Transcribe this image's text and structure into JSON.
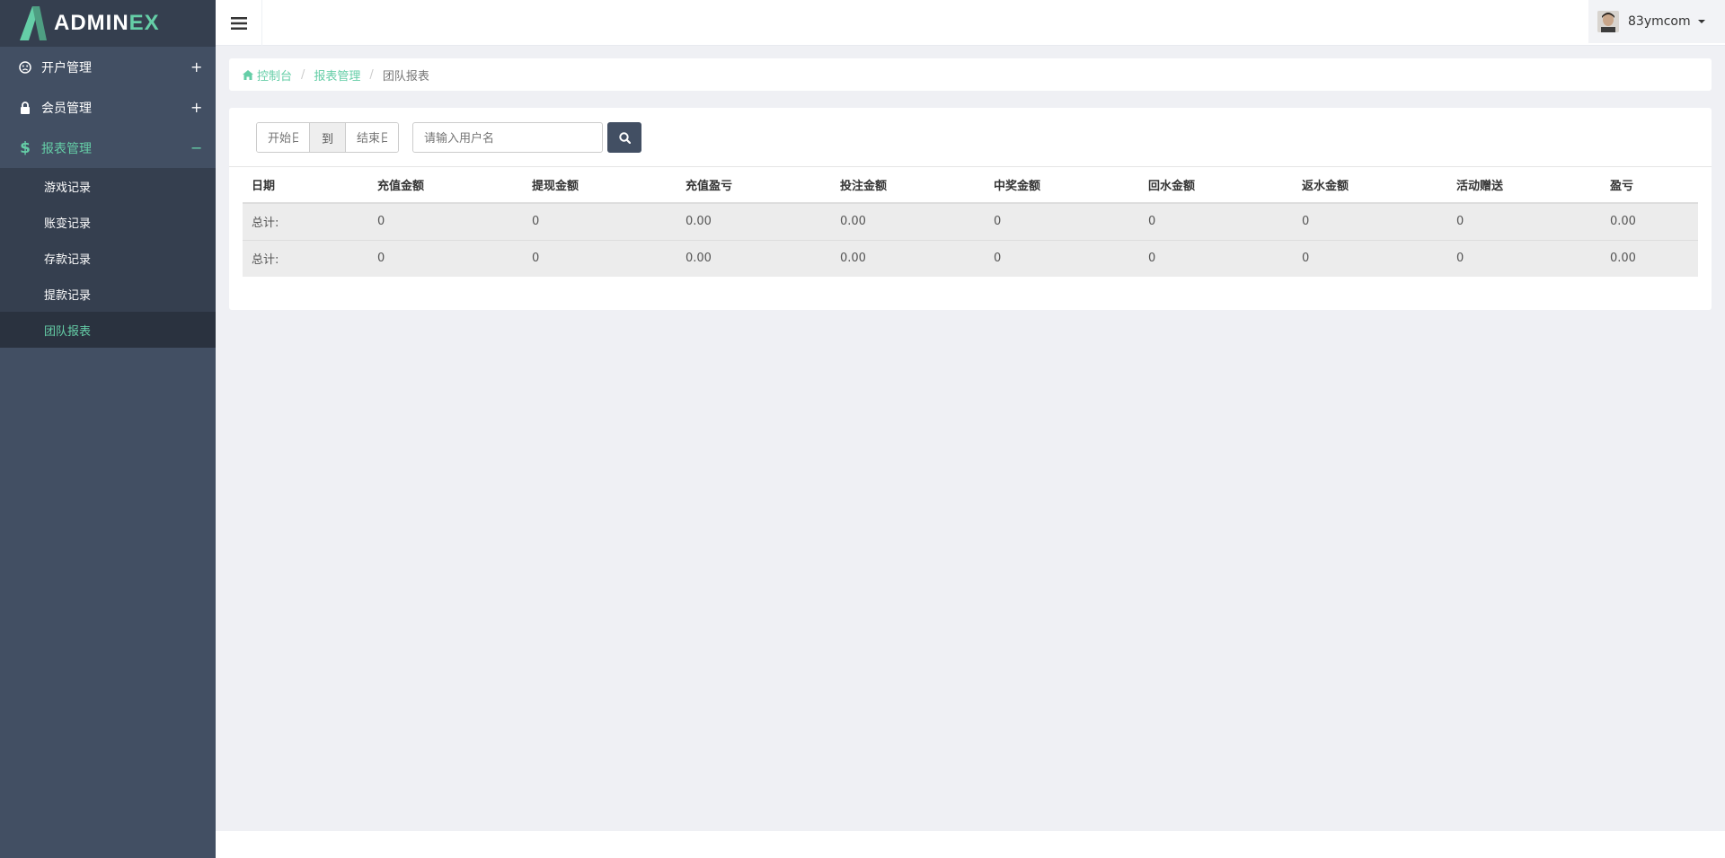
{
  "brand": {
    "name_main": "ADMIN",
    "name_accent": "EX"
  },
  "sidebar": {
    "menu": [
      {
        "label": "开户管理",
        "icon": "frown-icon",
        "toggle": "+"
      },
      {
        "label": "会员管理",
        "icon": "lock-icon",
        "toggle": "+"
      },
      {
        "label": "报表管理",
        "icon": "dollar-icon",
        "toggle": "−"
      }
    ],
    "submenu": [
      {
        "label": "游戏记录"
      },
      {
        "label": "账变记录"
      },
      {
        "label": "存款记录"
      },
      {
        "label": "提款记录"
      },
      {
        "label": "团队报表"
      }
    ]
  },
  "header": {
    "username": "83ymcom"
  },
  "breadcrumb": {
    "home": "控制台",
    "section": "报表管理",
    "current": "团队报表"
  },
  "filter": {
    "start_placeholder": "开始日期",
    "separator": "到",
    "end_placeholder": "结束日期",
    "user_placeholder": "请输入用户名"
  },
  "table": {
    "headers": [
      "日期",
      "充值金额",
      "提现金额",
      "充值盈亏",
      "投注金额",
      "中奖金额",
      "回水金额",
      "返水金额",
      "活动赠送",
      "盈亏"
    ],
    "rows": [
      [
        "总计:",
        "0",
        "0",
        "0.00",
        "0.00",
        "0",
        "0",
        "0",
        "0",
        "0.00"
      ],
      [
        "总计:",
        "0",
        "0",
        "0.00",
        "0.00",
        "0",
        "0",
        "0",
        "0",
        "0.00"
      ]
    ]
  },
  "colors": {
    "accent": "#65cea7",
    "sidebar": "#424f63",
    "sidebar_dark": "#353f4f",
    "button": "#424f63"
  }
}
